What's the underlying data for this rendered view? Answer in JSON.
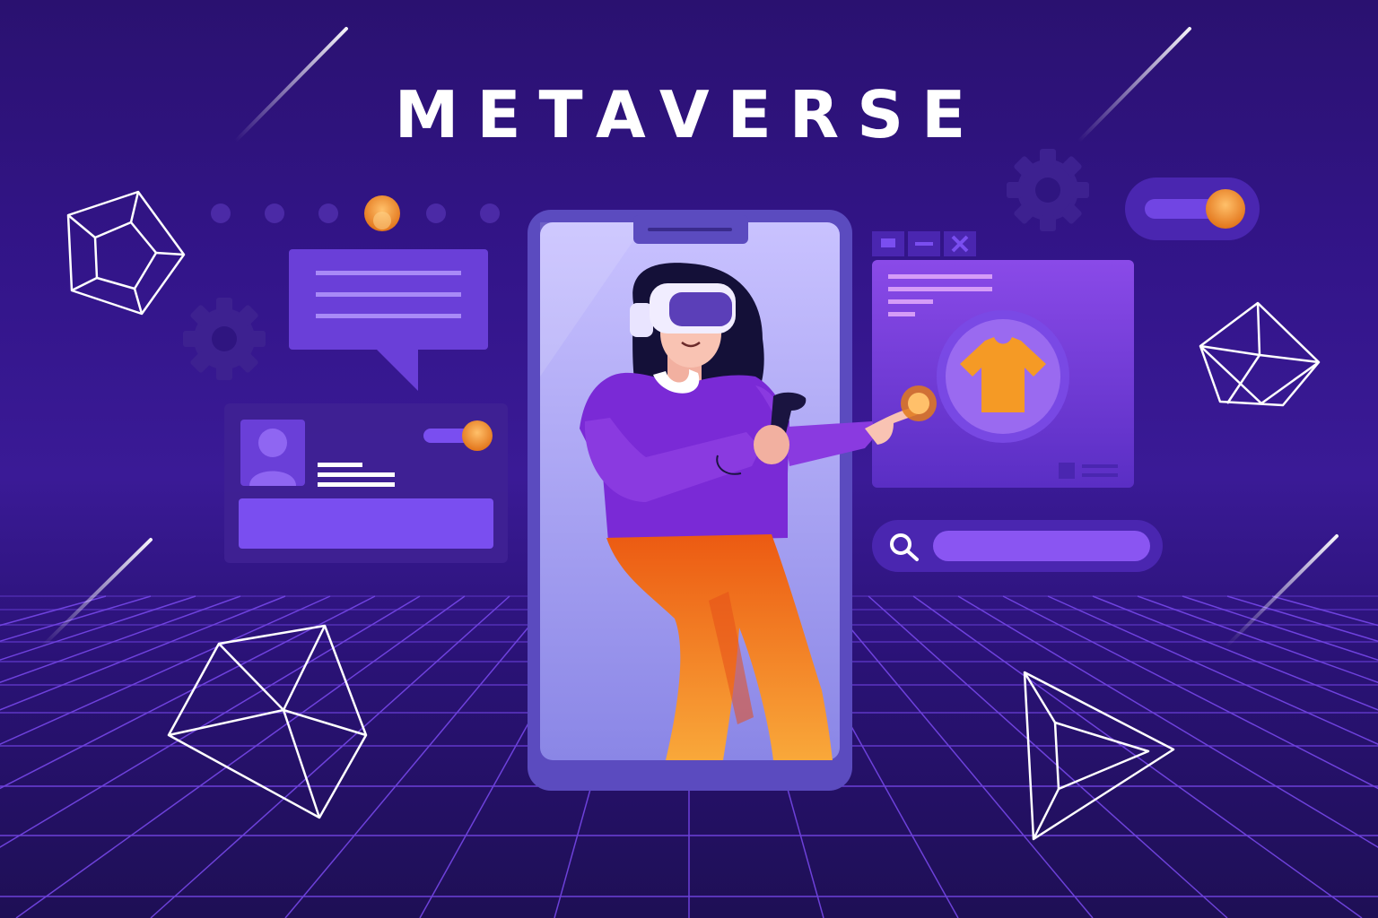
{
  "title": "METAVERSE",
  "colors": {
    "background_top": "#2a1170",
    "background_bottom": "#1e0f55",
    "panel_purple": "#6a3fd8",
    "accent_orange": "#f5a623",
    "grid_line": "#7b4bf0",
    "wireframe": "#ffffff"
  },
  "icons": [
    "gear-icon",
    "toggle-switch",
    "chat-bubble-icon",
    "profile-card",
    "tshirt-icon",
    "search-icon",
    "window-minimize-icon",
    "window-close-icon",
    "vr-headset-icon",
    "controller-icon",
    "dodecahedron-wireframe",
    "cube-wireframe",
    "pyramid-wireframe"
  ],
  "carousel": {
    "dot_count": 6,
    "active_index": 3
  },
  "toggles": {
    "top_right_on": true,
    "profile_card_on": true
  }
}
